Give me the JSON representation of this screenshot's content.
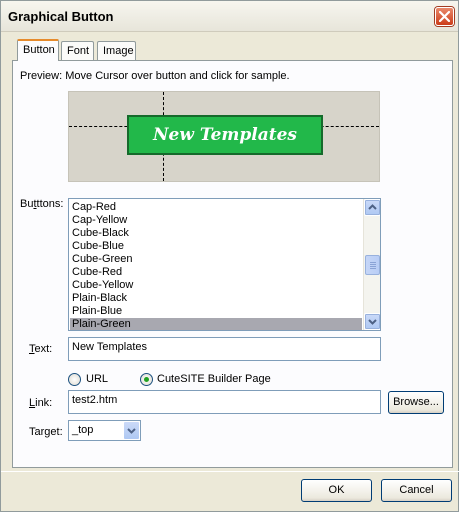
{
  "window": {
    "title": "Graphical Button"
  },
  "tabs": [
    {
      "label": "Button",
      "active": true
    },
    {
      "label": "Font",
      "active": false
    },
    {
      "label": "Image",
      "active": false
    }
  ],
  "preview": {
    "label": "Preview: Move Cursor over button and click for sample.",
    "sample_text": "New Templates",
    "sample_color": "#22b84a"
  },
  "buttons_list": {
    "label_prefix": "Bu",
    "label_accel": "t",
    "label_suffix": "ttons:",
    "items": [
      "Cap-Red",
      "Cap-Yellow",
      "Cube-Black",
      "Cube-Blue",
      "Cube-Green",
      "Cube-Red",
      "Cube-Yellow",
      "Plain-Black",
      "Plain-Blue",
      "Plain-Green"
    ],
    "selected": "Plain-Green"
  },
  "text_field": {
    "label_accel": "T",
    "label_rest": "ext:",
    "value": "New Templates"
  },
  "link_type": {
    "options": [
      {
        "label": "URL",
        "selected": false
      },
      {
        "label": "CuteSITE Builder Page",
        "selected": true
      }
    ]
  },
  "link_field": {
    "label_accel": "L",
    "label_rest": "ink:",
    "value": "test2.htm",
    "browse_label": "Browse..."
  },
  "target": {
    "label_prefix": "Tar",
    "label_accel": "g",
    "label_suffix": "et:",
    "value": "_top"
  },
  "footer": {
    "ok_label": "OK",
    "cancel_label": "Cancel"
  },
  "icons": {
    "close": "close-icon",
    "scroll_up": "scroll-up-arrow-icon",
    "scroll_down": "scroll-down-arrow-icon",
    "dropdown": "chevron-down-icon"
  }
}
